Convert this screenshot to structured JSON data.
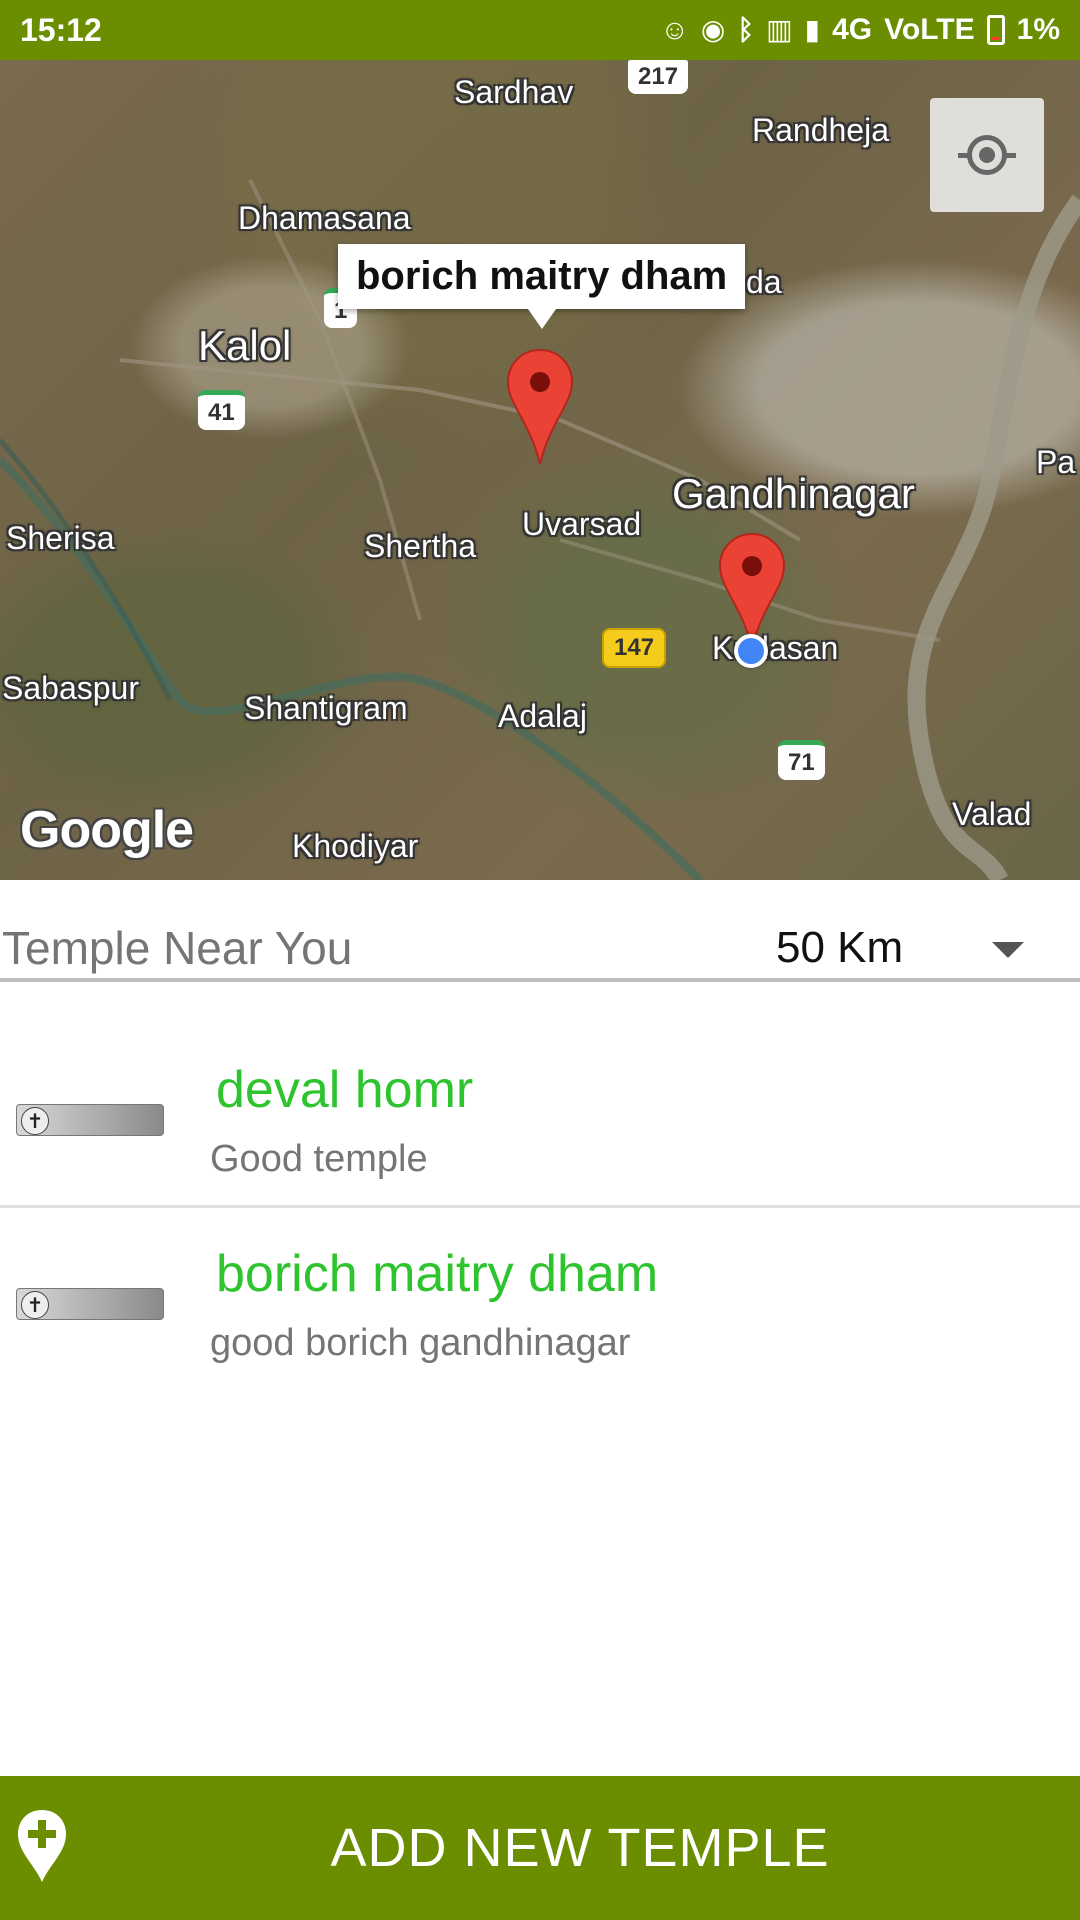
{
  "status_bar": {
    "time": "15:12",
    "network": "4G",
    "volte": "VoLTE",
    "battery": "1%"
  },
  "map": {
    "places": {
      "sardhav": "Sardhav",
      "randheja": "Randheja",
      "dhamasana": "Dhamasana",
      "kalol": "Kalol",
      "sherisa": "Sherisa",
      "shertha": "Shertha",
      "uvarsad": "Uvarsad",
      "gandhinagar": "Gandhinagar",
      "kudasan": "Kudasan",
      "sabaspur": "Sabaspur",
      "shantigram": "Shantigram",
      "adalaj": "Adalaj",
      "khodiyar": "Khodiyar",
      "valad": "Valad",
      "pa": "Pa",
      "da": "da"
    },
    "shields": {
      "r217": "217",
      "r41": "41",
      "r147": "147",
      "r71": "71",
      "r1": "1"
    },
    "info_window": "borich maitry dham",
    "attribution": "Google"
  },
  "filter": {
    "label": "Temple Near You",
    "distance": "50 Km"
  },
  "temples": [
    {
      "name": "deval homr",
      "description": "Good temple"
    },
    {
      "name": "borich maitry dham",
      "description": "good borich gandhinagar"
    }
  ],
  "bottom_button": {
    "label": "ADD NEW TEMPLE"
  },
  "colors": {
    "primary": "#6b8e00",
    "temple_name": "#2ec42e"
  }
}
